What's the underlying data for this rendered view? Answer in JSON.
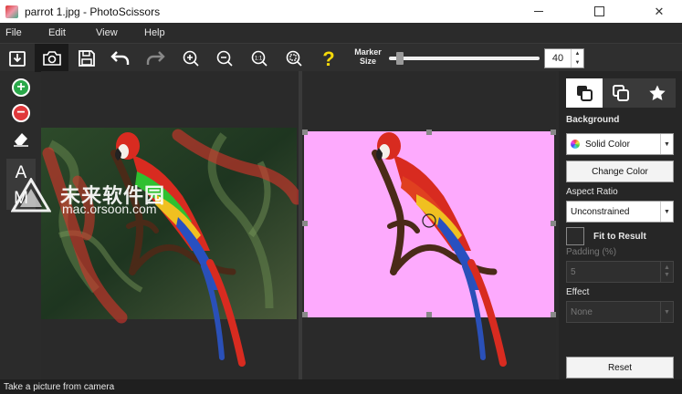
{
  "window": {
    "title": "parrot 1.jpg - PhotoScissors",
    "minimize_glyph": "",
    "maximize_glyph": "",
    "close_glyph": "✕"
  },
  "menu": [
    "File",
    "Edit",
    "View",
    "Help"
  ],
  "toolbar": {
    "marker_label_1": "Marker",
    "marker_label_2": "Size",
    "marker_size": "40",
    "marker_slider_fraction": 0.05
  },
  "sidebar": {
    "background_label": "Background",
    "background_mode": "Solid Color",
    "change_color_label": "Change Color",
    "aspect_ratio_label": "Aspect Ratio",
    "aspect_ratio_value": "Unconstrained",
    "fit_to_result_label": "Fit to Result",
    "padding_label": "Padding (%)",
    "padding_value": "5",
    "effect_label": "Effect",
    "effect_value": "None",
    "reset_label": "Reset"
  },
  "status": {
    "text": "Take a picture from camera"
  },
  "watermark": {
    "main": "未来软件园",
    "sub": "mac.orsoon.com"
  },
  "colors": {
    "result_background": "#fdaafd",
    "accent_add": "#2aa84a",
    "accent_remove": "#e0383b"
  }
}
